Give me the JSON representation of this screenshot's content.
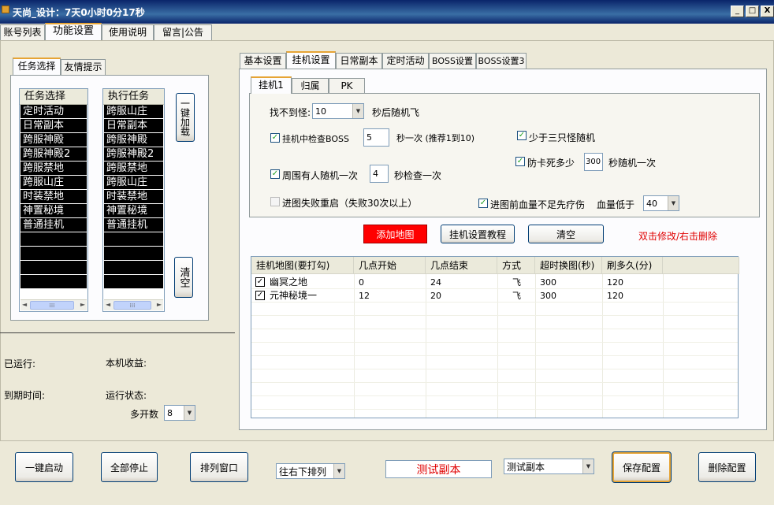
{
  "window": {
    "title": "天尚_设计：7天0小时0分17秒",
    "min_label": "_",
    "max_label": "□",
    "close_label": "X"
  },
  "top_tabs": [
    "账号列表",
    "功能设置",
    "使用说明",
    "留言|公告"
  ],
  "left_tabs": [
    "任务选择",
    "友情提示"
  ],
  "task_list": {
    "header": "任务选择",
    "items": [
      "定时活动",
      "日常副本",
      "跨服神殿",
      "跨服神殿2",
      "跨服禁地",
      "跨服山庄",
      "时装禁地",
      "神置秘境",
      "普通挂机"
    ]
  },
  "exec_list": {
    "header": "执行任务",
    "items": [
      "跨服山庄",
      "日常副本",
      "跨服神殿",
      "跨服神殿2",
      "跨服禁地",
      "跨服山庄",
      "时装禁地",
      "神置秘境",
      "普通挂机"
    ]
  },
  "buttons": {
    "one_key_load": "一键加载",
    "clear_side": "清空",
    "add_map": "添加地图",
    "tutorial": "挂机设置教程",
    "clear": "清空"
  },
  "status": {
    "running_label": "已运行:",
    "earnings_label": "本机收益:",
    "expire_label": "到期时间:",
    "run_state_label": "运行状态:",
    "multi_open_label": "多开数",
    "multi_open_value": "8"
  },
  "main_tabs": [
    "基本设置",
    "挂机设置",
    "日常副本",
    "定时活动",
    "BOSS设置",
    "BOSS设置3"
  ],
  "sub_tabs": [
    "挂机1",
    "归属",
    "PK"
  ],
  "settings": {
    "cant_find_label": "找不到怪:",
    "cant_find_value": "10",
    "cant_find_suffix": "秒后随机飞",
    "check_boss_label": "挂机中检查BOSS",
    "check_boss_value": "5",
    "check_boss_suffix": "秒一次 (推荐1到10)",
    "less_three_label": "少于三只怪随机",
    "nearby_label": "周围有人随机一次",
    "nearby_value": "4",
    "nearby_suffix": "秒检查一次",
    "anti_stuck_label": "防卡死多少",
    "anti_stuck_value": "300",
    "anti_stuck_suffix": "秒随机一次",
    "restart_label": "进图失败重启（失败30次以上）",
    "heal_label": "进图前血量不足先疗伤",
    "hp_low_label": "血量低于",
    "hp_low_value": "40"
  },
  "hint_text": "双击修改/右击删除",
  "grid": {
    "headers": [
      "挂机地图(要打勾)",
      "几点开始",
      "几点结束",
      "方式",
      "超时换图(秒)",
      "刷多久(分)"
    ],
    "rows": [
      {
        "checked": true,
        "map": "幽冥之地",
        "start": "0",
        "end": "24",
        "mode": "飞",
        "timeout": "300",
        "duration": "120"
      },
      {
        "checked": true,
        "map": "元神秘境一",
        "start": "12",
        "end": "20",
        "mode": "飞",
        "timeout": "300",
        "duration": "120"
      }
    ]
  },
  "bottom": {
    "start_all": "一键启动",
    "stop_all": "全部停止",
    "arrange": "排列窗口",
    "arrange_mode": "往右下排列",
    "test_dungeon_text": "测试副本",
    "dungeon_select": "测试副本",
    "save": "保存配置",
    "delete": "删除配置"
  },
  "colors": {
    "add_map_bg": "#ff0000",
    "hint": "#e00000",
    "test_text": "#e00000"
  }
}
